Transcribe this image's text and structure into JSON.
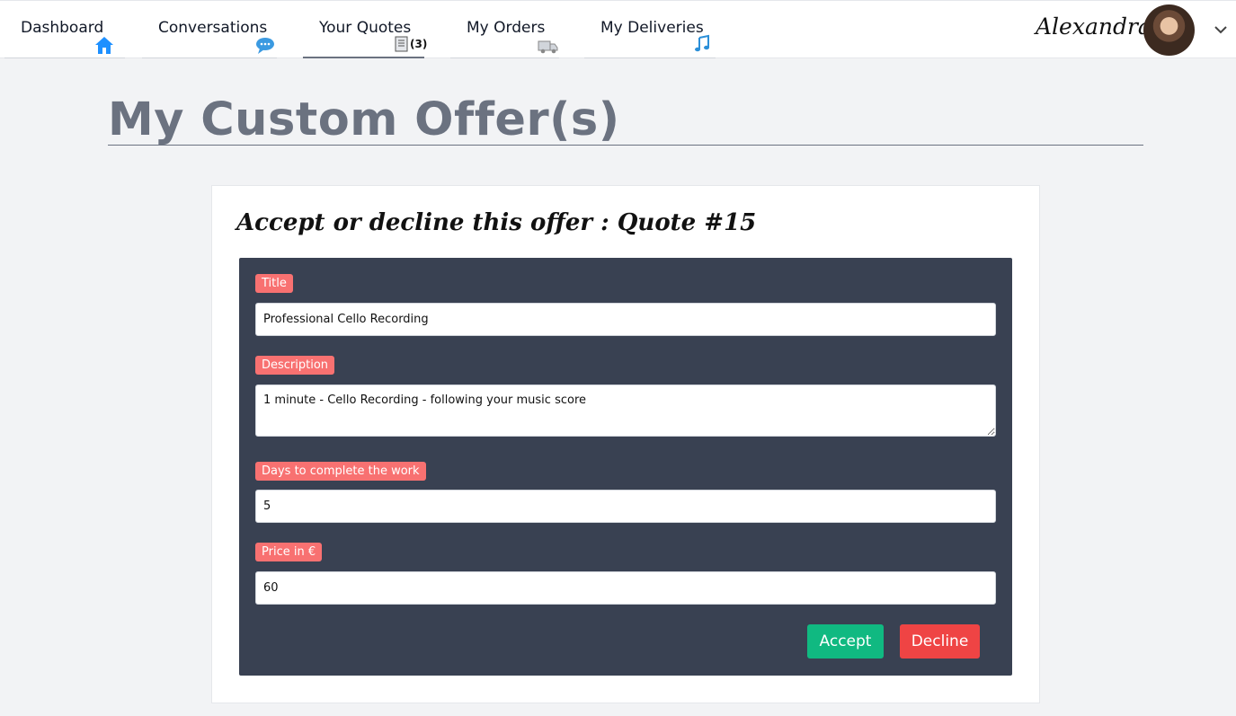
{
  "nav": {
    "items": [
      {
        "label": "Dashboard",
        "icon": "home-icon"
      },
      {
        "label": "Conversations",
        "icon": "chat-bubbles-icon"
      },
      {
        "label": "Your Quotes",
        "icon": "document-icon",
        "count": "(3)"
      },
      {
        "label": "My Orders",
        "icon": "delivery-truck-icon"
      },
      {
        "label": "My Deliveries",
        "icon": "music-note-icon"
      }
    ],
    "active": "Your Quotes"
  },
  "user": {
    "name": "Alexandra"
  },
  "page": {
    "title": "My Custom Offer(s)"
  },
  "offer": {
    "heading": "Accept or decline this offer : Quote #15",
    "fields": {
      "title": {
        "label": "Title",
        "value": "Professional Cello Recording"
      },
      "description": {
        "label": "Description",
        "value": "1 minute - Cello Recording - following your music score"
      },
      "days": {
        "label": "Days to complete the work",
        "value": "5"
      },
      "price": {
        "label": "Price in €",
        "value": "60"
      }
    },
    "accept_label": "Accept",
    "decline_label": "Decline"
  },
  "colors": {
    "accept": "#10b981",
    "decline": "#ef4444",
    "badge": "#f87171",
    "panel": "#394152"
  }
}
